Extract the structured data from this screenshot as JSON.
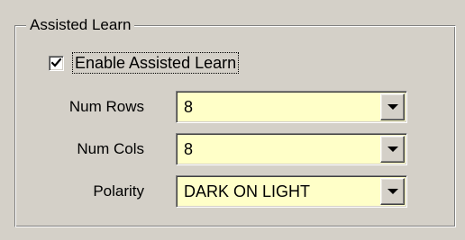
{
  "group": {
    "title": "Assisted Learn"
  },
  "enable_assisted_learn": {
    "label": "Enable Assisted Learn",
    "checked": true
  },
  "fields": [
    {
      "label": "Num Rows",
      "value": "8"
    },
    {
      "label": "Num Cols",
      "value": "8"
    },
    {
      "label": "Polarity",
      "value": "DARK ON LIGHT"
    }
  ],
  "colors": {
    "dialog_bg": "#d4d0c8",
    "combo_bg": "#ffffc8"
  },
  "icons": {
    "checkbox_mark": "check-icon",
    "dropdown": "chevron-down-icon"
  }
}
